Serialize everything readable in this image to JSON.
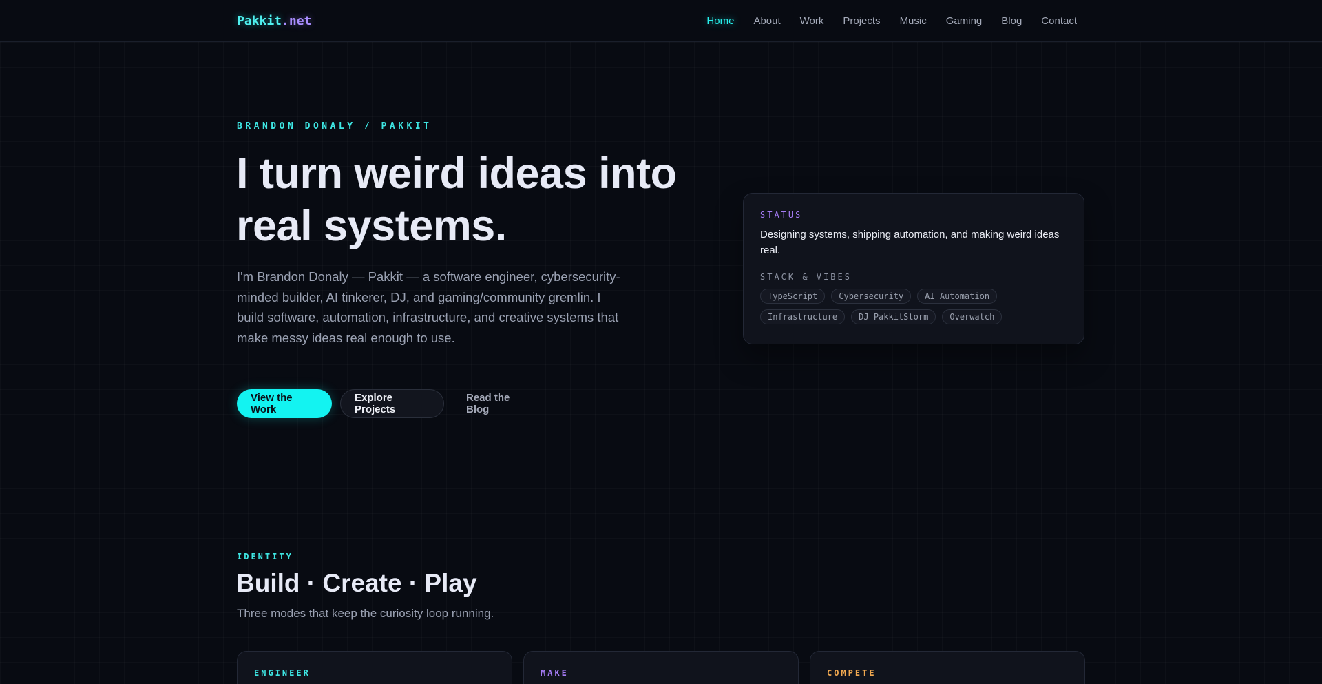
{
  "header": {
    "logo_main": "Pakkit",
    "logo_tld": ".net",
    "nav": [
      {
        "label": "Home",
        "active": true
      },
      {
        "label": "About"
      },
      {
        "label": "Work"
      },
      {
        "label": "Projects"
      },
      {
        "label": "Music"
      },
      {
        "label": "Gaming"
      },
      {
        "label": "Blog"
      },
      {
        "label": "Contact"
      }
    ]
  },
  "hero": {
    "eyebrow": "BRANDON DONALY / PAKKIT",
    "title": "I turn weird ideas into real systems.",
    "description": "I'm Brandon Donaly — Pakkit — a software engineer, cybersecurity-minded builder, AI tinkerer, DJ, and gaming/community gremlin. I build software, automation, infrastructure, and creative systems that make messy ideas real enough to use.",
    "buttons": {
      "primary": "View the Work",
      "secondary": "Explore Projects",
      "ghost": "Read the Blog"
    }
  },
  "status_card": {
    "label": "STATUS",
    "text": "Designing systems, shipping automation, and making weird ideas real.",
    "stack_label": "STACK & VIBES",
    "tags": [
      "TypeScript",
      "Cybersecurity",
      "AI Automation",
      "Infrastructure",
      "DJ PakkitStorm",
      "Overwatch"
    ]
  },
  "identity": {
    "eyebrow": "IDENTITY",
    "title": "Build · Create · Play",
    "subtitle": "Three modes that keep the curiosity loop running.",
    "cards": [
      {
        "label": "ENGINEER",
        "color": "#3ee6e3"
      },
      {
        "label": "MAKE",
        "color": "#a57cf5"
      },
      {
        "label": "COMPETE",
        "color": "#f0a850"
      }
    ]
  },
  "colors": {
    "accent_cyan": "#13f3f1",
    "accent_purple": "#a57cf5",
    "accent_orange": "#f0a850",
    "background": "#080b12"
  }
}
